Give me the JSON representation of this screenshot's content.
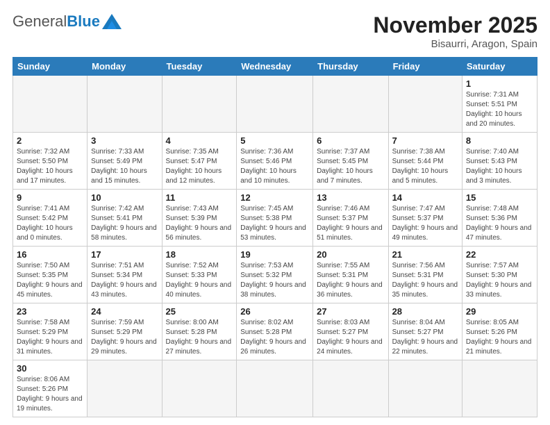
{
  "header": {
    "logo_general": "General",
    "logo_blue": "Blue",
    "month_title": "November 2025",
    "location": "Bisaurri, Aragon, Spain"
  },
  "weekdays": [
    "Sunday",
    "Monday",
    "Tuesday",
    "Wednesday",
    "Thursday",
    "Friday",
    "Saturday"
  ],
  "weeks": [
    [
      {
        "day": "",
        "info": ""
      },
      {
        "day": "",
        "info": ""
      },
      {
        "day": "",
        "info": ""
      },
      {
        "day": "",
        "info": ""
      },
      {
        "day": "",
        "info": ""
      },
      {
        "day": "",
        "info": ""
      },
      {
        "day": "1",
        "info": "Sunrise: 7:31 AM\nSunset: 5:51 PM\nDaylight: 10 hours and 20 minutes."
      }
    ],
    [
      {
        "day": "2",
        "info": "Sunrise: 7:32 AM\nSunset: 5:50 PM\nDaylight: 10 hours and 17 minutes."
      },
      {
        "day": "3",
        "info": "Sunrise: 7:33 AM\nSunset: 5:49 PM\nDaylight: 10 hours and 15 minutes."
      },
      {
        "day": "4",
        "info": "Sunrise: 7:35 AM\nSunset: 5:47 PM\nDaylight: 10 hours and 12 minutes."
      },
      {
        "day": "5",
        "info": "Sunrise: 7:36 AM\nSunset: 5:46 PM\nDaylight: 10 hours and 10 minutes."
      },
      {
        "day": "6",
        "info": "Sunrise: 7:37 AM\nSunset: 5:45 PM\nDaylight: 10 hours and 7 minutes."
      },
      {
        "day": "7",
        "info": "Sunrise: 7:38 AM\nSunset: 5:44 PM\nDaylight: 10 hours and 5 minutes."
      },
      {
        "day": "8",
        "info": "Sunrise: 7:40 AM\nSunset: 5:43 PM\nDaylight: 10 hours and 3 minutes."
      }
    ],
    [
      {
        "day": "9",
        "info": "Sunrise: 7:41 AM\nSunset: 5:42 PM\nDaylight: 10 hours and 0 minutes."
      },
      {
        "day": "10",
        "info": "Sunrise: 7:42 AM\nSunset: 5:41 PM\nDaylight: 9 hours and 58 minutes."
      },
      {
        "day": "11",
        "info": "Sunrise: 7:43 AM\nSunset: 5:39 PM\nDaylight: 9 hours and 56 minutes."
      },
      {
        "day": "12",
        "info": "Sunrise: 7:45 AM\nSunset: 5:38 PM\nDaylight: 9 hours and 53 minutes."
      },
      {
        "day": "13",
        "info": "Sunrise: 7:46 AM\nSunset: 5:37 PM\nDaylight: 9 hours and 51 minutes."
      },
      {
        "day": "14",
        "info": "Sunrise: 7:47 AM\nSunset: 5:37 PM\nDaylight: 9 hours and 49 minutes."
      },
      {
        "day": "15",
        "info": "Sunrise: 7:48 AM\nSunset: 5:36 PM\nDaylight: 9 hours and 47 minutes."
      }
    ],
    [
      {
        "day": "16",
        "info": "Sunrise: 7:50 AM\nSunset: 5:35 PM\nDaylight: 9 hours and 45 minutes."
      },
      {
        "day": "17",
        "info": "Sunrise: 7:51 AM\nSunset: 5:34 PM\nDaylight: 9 hours and 43 minutes."
      },
      {
        "day": "18",
        "info": "Sunrise: 7:52 AM\nSunset: 5:33 PM\nDaylight: 9 hours and 40 minutes."
      },
      {
        "day": "19",
        "info": "Sunrise: 7:53 AM\nSunset: 5:32 PM\nDaylight: 9 hours and 38 minutes."
      },
      {
        "day": "20",
        "info": "Sunrise: 7:55 AM\nSunset: 5:31 PM\nDaylight: 9 hours and 36 minutes."
      },
      {
        "day": "21",
        "info": "Sunrise: 7:56 AM\nSunset: 5:31 PM\nDaylight: 9 hours and 35 minutes."
      },
      {
        "day": "22",
        "info": "Sunrise: 7:57 AM\nSunset: 5:30 PM\nDaylight: 9 hours and 33 minutes."
      }
    ],
    [
      {
        "day": "23",
        "info": "Sunrise: 7:58 AM\nSunset: 5:29 PM\nDaylight: 9 hours and 31 minutes."
      },
      {
        "day": "24",
        "info": "Sunrise: 7:59 AM\nSunset: 5:29 PM\nDaylight: 9 hours and 29 minutes."
      },
      {
        "day": "25",
        "info": "Sunrise: 8:00 AM\nSunset: 5:28 PM\nDaylight: 9 hours and 27 minutes."
      },
      {
        "day": "26",
        "info": "Sunrise: 8:02 AM\nSunset: 5:28 PM\nDaylight: 9 hours and 26 minutes."
      },
      {
        "day": "27",
        "info": "Sunrise: 8:03 AM\nSunset: 5:27 PM\nDaylight: 9 hours and 24 minutes."
      },
      {
        "day": "28",
        "info": "Sunrise: 8:04 AM\nSunset: 5:27 PM\nDaylight: 9 hours and 22 minutes."
      },
      {
        "day": "29",
        "info": "Sunrise: 8:05 AM\nSunset: 5:26 PM\nDaylight: 9 hours and 21 minutes."
      }
    ],
    [
      {
        "day": "30",
        "info": "Sunrise: 8:06 AM\nSunset: 5:26 PM\nDaylight: 9 hours and 19 minutes."
      },
      {
        "day": "",
        "info": ""
      },
      {
        "day": "",
        "info": ""
      },
      {
        "day": "",
        "info": ""
      },
      {
        "day": "",
        "info": ""
      },
      {
        "day": "",
        "info": ""
      },
      {
        "day": "",
        "info": ""
      }
    ]
  ]
}
